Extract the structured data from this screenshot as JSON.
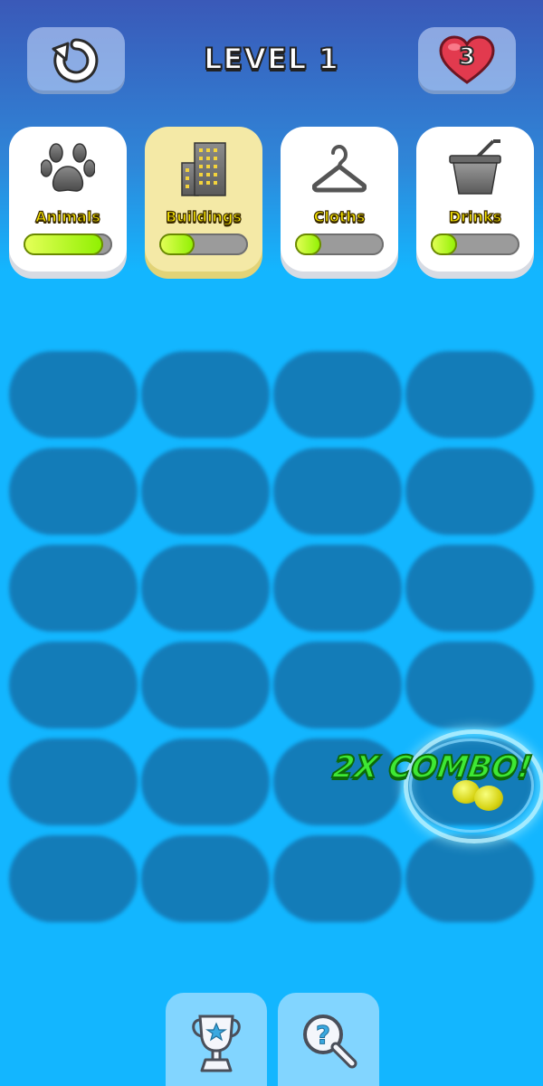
{
  "header": {
    "level_title": "LEVEL 1",
    "lives": "3",
    "restart_icon": "restart-arrow-icon",
    "lives_icon": "heart-icon"
  },
  "categories": [
    {
      "label": "Animals",
      "icon": "paw-icon",
      "progress": 0.9,
      "active": false
    },
    {
      "label": "Buildings",
      "icon": "building-icon",
      "progress": 0.4,
      "active": true
    },
    {
      "label": "Cloths",
      "icon": "hanger-icon",
      "progress": 0.3,
      "active": false
    },
    {
      "label": "Drinks",
      "icon": "cup-icon",
      "progress": 0.3,
      "active": false
    }
  ],
  "board": {
    "rows": 6,
    "cols": 4,
    "slot_state": "empty"
  },
  "combo": {
    "text": "2X COMBO!"
  },
  "bottom": {
    "trophy_icon": "trophy-icon",
    "hint_icon": "magnifier-question-icon"
  },
  "colors": {
    "accent_yellow": "#f6e400",
    "progress_fill": "#8ef000",
    "combo_green": "#3ee834",
    "heart_red": "#e23a4e",
    "background_blue": "#13b6ff"
  }
}
